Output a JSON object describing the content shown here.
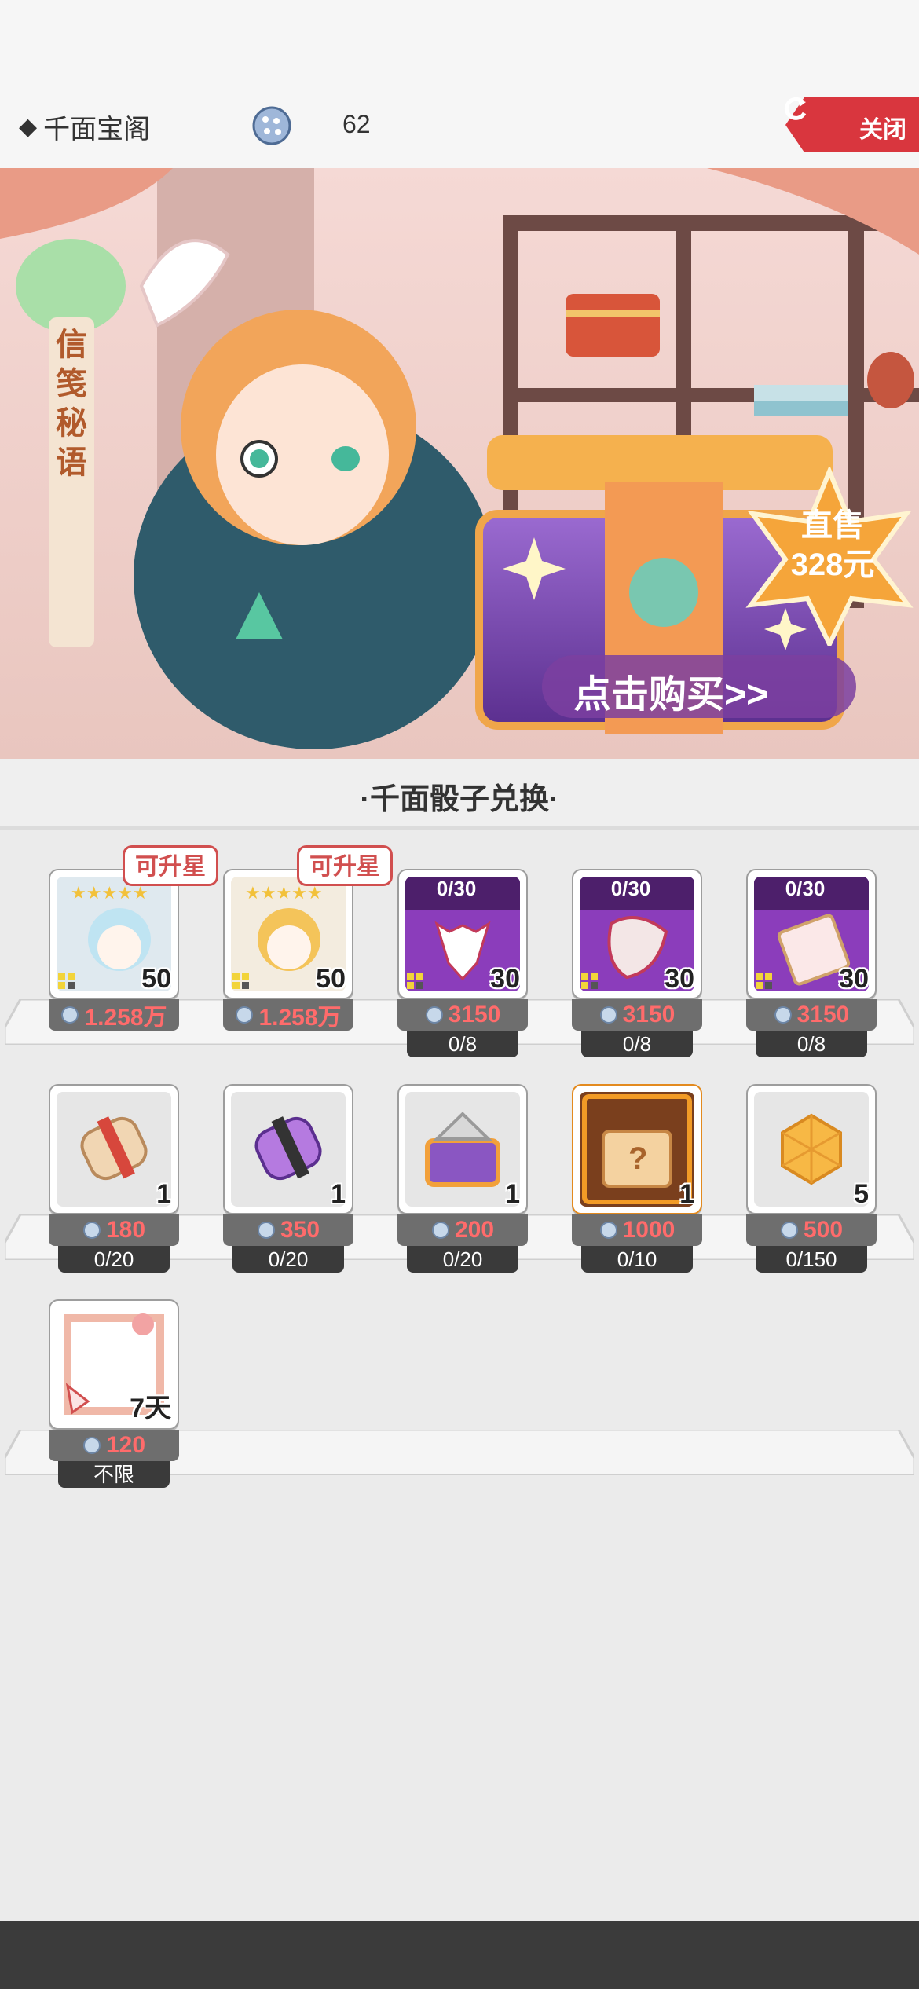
{
  "header": {
    "title": "千面宝阁",
    "dice_count": "62",
    "close_label": "关闭"
  },
  "banner": {
    "tag": "信笺秘语",
    "price_line1": "直售",
    "price_line2": "328元",
    "buy_text": "点击购买>>"
  },
  "section": {
    "title": "·千面骰子兑换·"
  },
  "items": [
    {
      "qty": "50",
      "price": "1.258万",
      "limit": "",
      "badge": "可升星"
    },
    {
      "qty": "50",
      "price": "1.258万",
      "limit": "",
      "badge": "可升星"
    },
    {
      "qty": "30",
      "price": "3150",
      "limit": "0/8",
      "progress": "0/30"
    },
    {
      "qty": "30",
      "price": "3150",
      "limit": "0/8",
      "progress": "0/30"
    },
    {
      "qty": "30",
      "price": "3150",
      "limit": "0/8",
      "progress": "0/30"
    },
    {
      "qty": "1",
      "price": "180",
      "limit": "0/20"
    },
    {
      "qty": "1",
      "price": "350",
      "limit": "0/20"
    },
    {
      "qty": "1",
      "price": "200",
      "limit": "0/20"
    },
    {
      "qty": "1",
      "price": "1000",
      "limit": "0/10"
    },
    {
      "qty": "5",
      "price": "500",
      "limit": "0/150"
    },
    {
      "qty": "7天",
      "price": "120",
      "limit": "不限"
    }
  ],
  "colors": {
    "accent_red": "#d9363e",
    "price_red": "#ff6b6b",
    "purple": "#7b3fa0"
  }
}
